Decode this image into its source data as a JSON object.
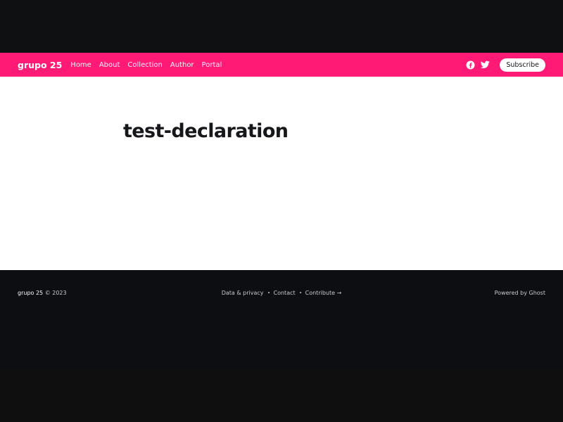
{
  "header": {
    "brand": "grupo 25",
    "nav": [
      "Home",
      "About",
      "Collection",
      "Author",
      "Portal"
    ],
    "subscribe_label": "Subscribe",
    "social_icons": [
      "facebook-icon",
      "twitter-icon"
    ],
    "accent_color": "#ff1a75"
  },
  "main": {
    "title": "test-declaration"
  },
  "footer": {
    "brand": "grupo 25",
    "copyright": "© 2023",
    "links": [
      "Data & privacy",
      "Contact",
      "Contribute →"
    ],
    "powered_by": "Powered by Ghost"
  }
}
